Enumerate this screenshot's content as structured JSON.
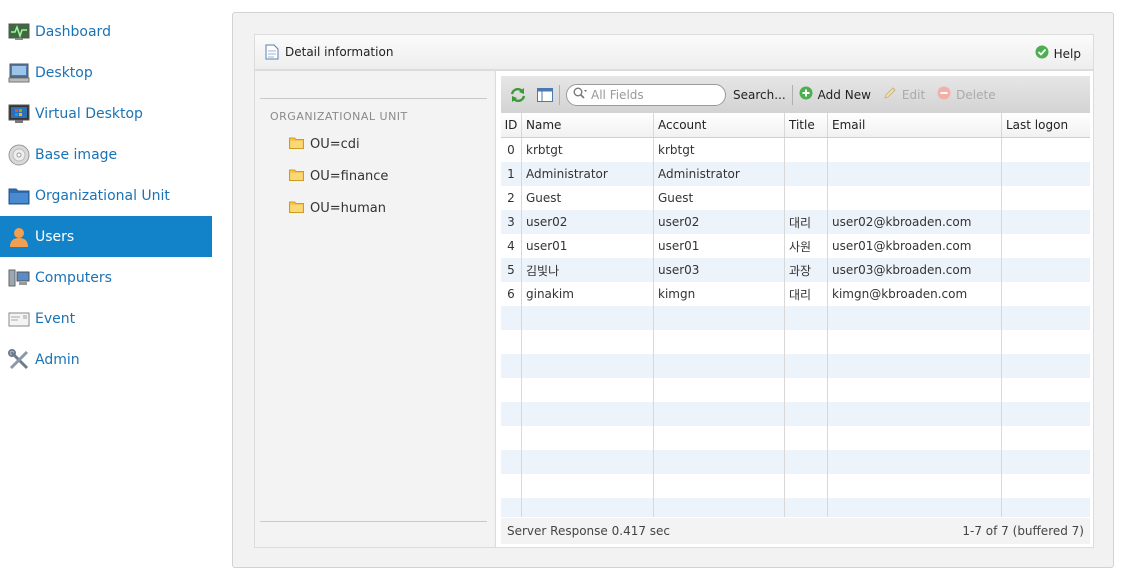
{
  "sidebar": {
    "items": [
      {
        "label": "Dashboard",
        "icon": "dashboard-monitor-icon"
      },
      {
        "label": "Desktop",
        "icon": "desktop-computer-icon"
      },
      {
        "label": "Virtual Desktop",
        "icon": "virtual-desktop-icon"
      },
      {
        "label": "Base image",
        "icon": "disc-icon"
      },
      {
        "label": "Organizational Unit",
        "icon": "folder-blue-icon"
      },
      {
        "label": "Users",
        "icon": "user-icon",
        "active": true
      },
      {
        "label": "Computers",
        "icon": "computers-icon"
      },
      {
        "label": "Event",
        "icon": "event-envelope-icon"
      },
      {
        "label": "Admin",
        "icon": "tools-icon"
      }
    ]
  },
  "detail": {
    "title": "Detail information",
    "help_label": "Help"
  },
  "ou": {
    "heading": "ORGANIZATIONAL UNIT",
    "items": [
      "OU=cdi",
      "OU=finance",
      "OU=human"
    ]
  },
  "toolbar": {
    "search_placeholder": "All Fields",
    "search_label": "Search...",
    "add_label": "Add New",
    "edit_label": "Edit",
    "delete_label": "Delete"
  },
  "table": {
    "columns": [
      "ID",
      "Name",
      "Account",
      "Title",
      "Email",
      "Last logon"
    ],
    "rows": [
      [
        "0",
        "krbtgt",
        "krbtgt",
        "",
        "",
        ""
      ],
      [
        "1",
        "Administrator",
        "Administrator",
        "",
        "",
        ""
      ],
      [
        "2",
        "Guest",
        "Guest",
        "",
        "",
        ""
      ],
      [
        "3",
        "user02",
        "user02",
        "대리",
        "user02@kbroaden.com",
        ""
      ],
      [
        "4",
        "user01",
        "user01",
        "사원",
        "user01@kbroaden.com",
        ""
      ],
      [
        "5",
        "김빛나",
        "user03",
        "과장",
        "user03@kbroaden.com",
        ""
      ],
      [
        "6",
        "ginakim",
        "kimgn",
        "대리",
        "kimgn@kbroaden.com",
        ""
      ]
    ]
  },
  "footer": {
    "response": "Server Response 0.417 sec",
    "paging": "1-7 of 7 (buffered 7)"
  },
  "colors": {
    "accent": "#1383c9",
    "link": "#1a73b5",
    "row_alt": "#edf3fa"
  }
}
